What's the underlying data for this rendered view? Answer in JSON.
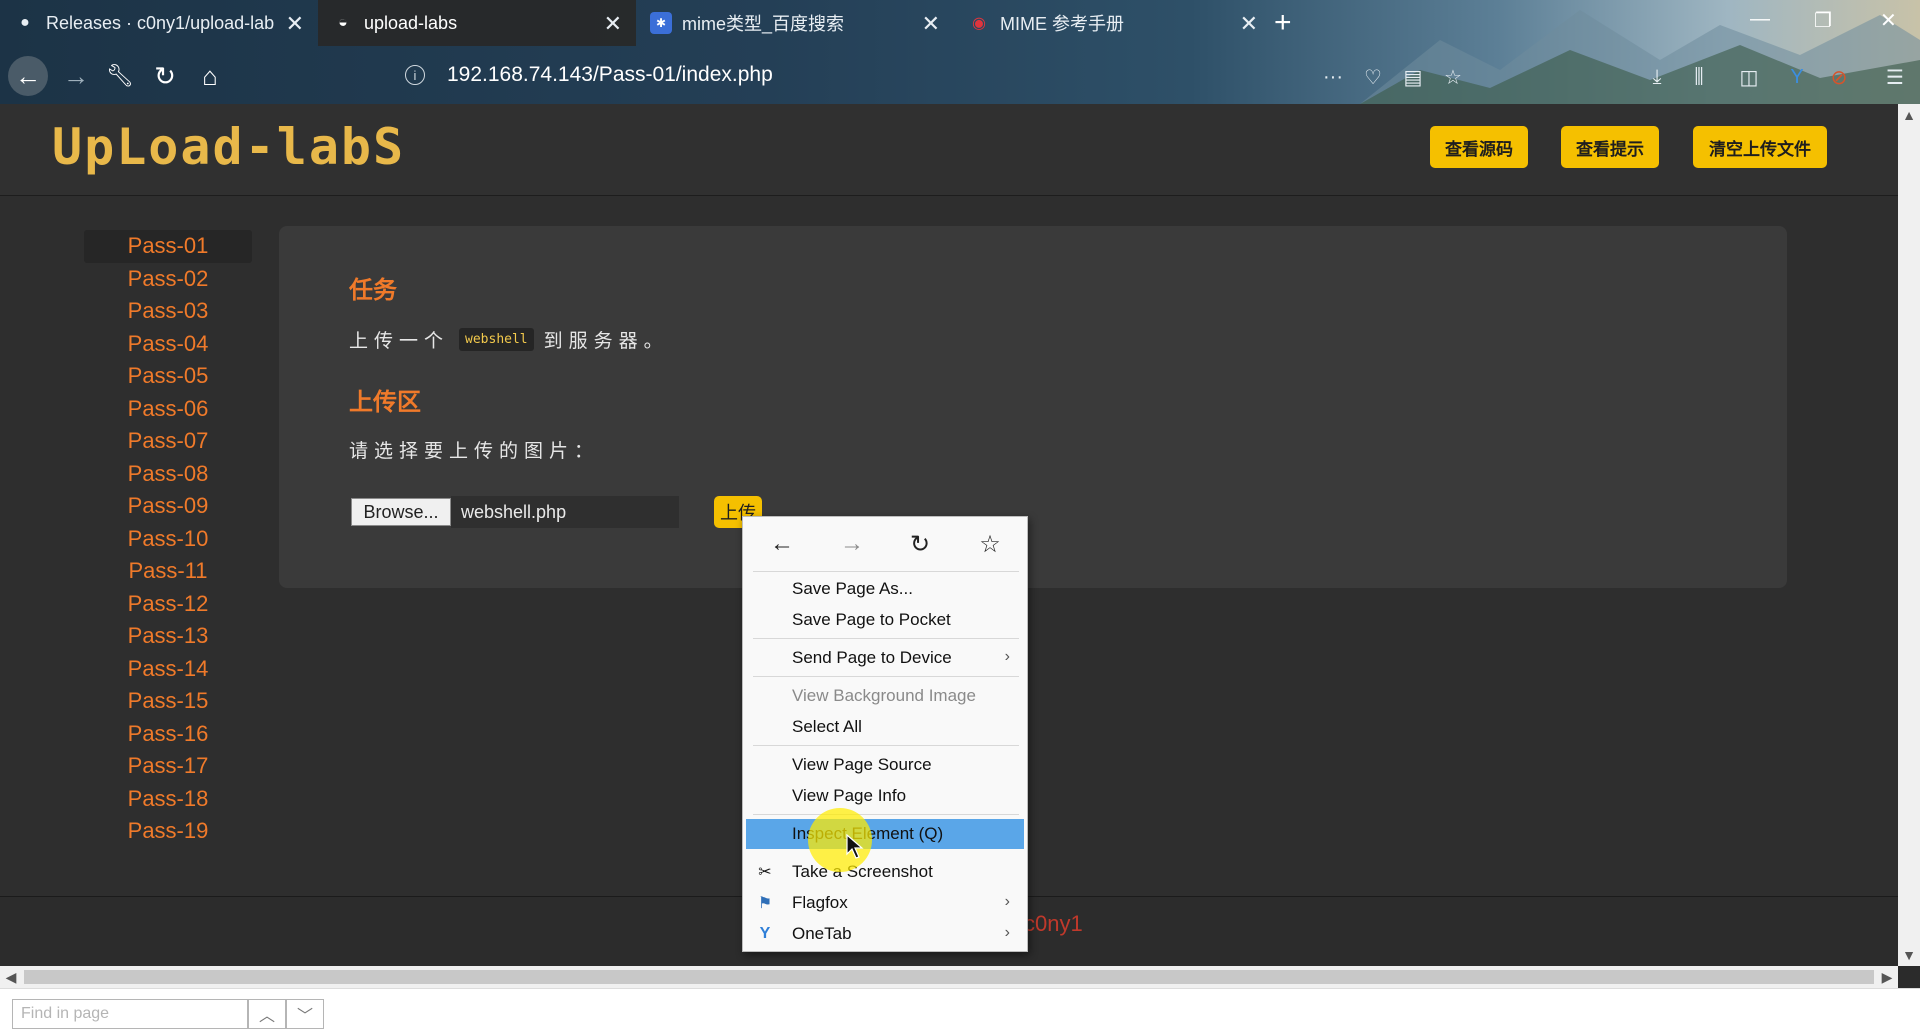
{
  "browser": {
    "tabs": [
      {
        "title": "Releases · c0ny1/upload-lab",
        "icon": "github-icon"
      },
      {
        "title": "upload-labs",
        "icon": "firefox-icon"
      },
      {
        "title": "mime类型_百度搜索",
        "icon": "baidu-icon"
      },
      {
        "title": "MIME 参考手册",
        "icon": "w3school-icon"
      }
    ],
    "new_tab": "+",
    "url": "192.168.74.143/Pass-01/index.php",
    "more": "···"
  },
  "header": {
    "logo_text": "UpLoad-labS",
    "buttons": [
      "查看源码",
      "查看提示",
      "清空上传文件"
    ]
  },
  "sidebar": {
    "items": [
      "Pass-01",
      "Pass-02",
      "Pass-03",
      "Pass-04",
      "Pass-05",
      "Pass-06",
      "Pass-07",
      "Pass-08",
      "Pass-09",
      "Pass-10",
      "Pass-11",
      "Pass-12",
      "Pass-13",
      "Pass-14",
      "Pass-15",
      "Pass-16",
      "Pass-17",
      "Pass-18",
      "Pass-19"
    ],
    "current": "Pass-01"
  },
  "main": {
    "task_heading": "任务",
    "task_prefix": "上传一个",
    "task_code": "webshell",
    "task_suffix": "到服务器。",
    "upload_heading": "上传区",
    "choose_prompt": "请选择要上传的图片：",
    "browse_label": "Browse...",
    "file_name": "webshell.php",
    "submit_label": "上传"
  },
  "footer": {
    "text": "c0ny1"
  },
  "context_menu": {
    "items": [
      {
        "label": "Save Page As...",
        "disabled": false
      },
      {
        "label": "Save Page to Pocket",
        "disabled": false
      },
      {
        "label": "Send Page to Device",
        "disabled": false,
        "submenu": true
      },
      {
        "label": "View Background Image",
        "disabled": true
      },
      {
        "label": "Select All",
        "disabled": false
      },
      {
        "label": "View Page Source",
        "disabled": false
      },
      {
        "label": "View Page Info",
        "disabled": false
      },
      {
        "label": "Inspect Element (Q)",
        "disabled": false,
        "highlighted": true
      },
      {
        "label": "Take a Screenshot",
        "disabled": false,
        "icon": "scissors-icon"
      },
      {
        "label": "Flagfox",
        "disabled": false,
        "submenu": true,
        "icon": "flag-icon"
      },
      {
        "label": "OneTab",
        "disabled": false,
        "submenu": true,
        "icon": "onetab-icon"
      }
    ]
  },
  "findbar": {
    "placeholder": "Find in page"
  },
  "colors": {
    "accent_orange": "#f07a2a",
    "button_yellow": "#f5c000",
    "highlight_blue": "#5aa6e8"
  }
}
